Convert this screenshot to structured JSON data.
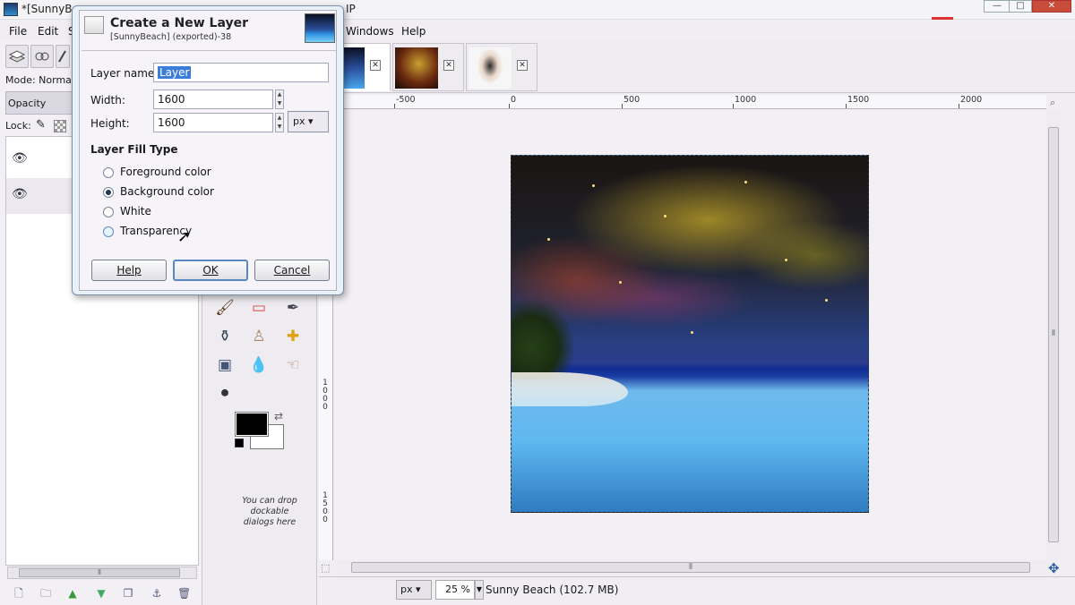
{
  "window": {
    "title": "*[SunnyBeac",
    "title_tail": "IP",
    "controls": {
      "minimize": "—",
      "maximize": "□",
      "close": "✕"
    }
  },
  "menubar": {
    "items": [
      "File",
      "Edit",
      "S",
      "Windows",
      "Help"
    ]
  },
  "layers_dock": {
    "mode_label": "Mode: Normal",
    "opacity_label": "Opacity",
    "lock_label": "Lock:",
    "scroll_handle": "⦀"
  },
  "toolbox": {
    "drop_hint": "You can drop dockable dialogs here",
    "foreground_color": "#000000",
    "background_color": "#ffffff"
  },
  "image_window": {
    "ruler_labels": [
      "-500",
      "0",
      "500",
      "1000",
      "1500",
      "2000"
    ],
    "vruler_labels": [
      "1000",
      "1500"
    ],
    "scroll_handle": "⦀",
    "status": {
      "unit": "px",
      "zoom": "25 %",
      "text": "Sunny Beach (102.7 MB)"
    }
  },
  "dialog": {
    "title": "Create a New Layer",
    "subtitle": "[SunnyBeach] (exported)-38",
    "layer_name_label": "Layer name:",
    "layer_name_value": "Layer",
    "width_label": "Width:",
    "width_value": "1600",
    "height_label": "Height:",
    "height_value": "1600",
    "unit": "px",
    "fill_heading": "Layer Fill Type",
    "fill_options": [
      "Foreground color",
      "Background color",
      "White",
      "Transparency"
    ],
    "fill_selected": "Background color",
    "buttons": {
      "help": "Help",
      "ok": "OK",
      "cancel": "Cancel"
    }
  }
}
